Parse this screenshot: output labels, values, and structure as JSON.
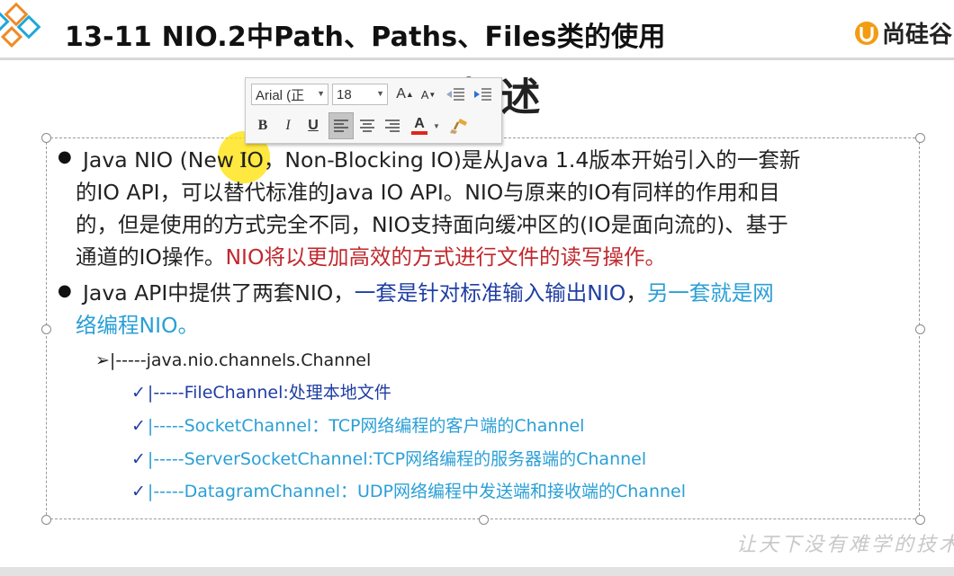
{
  "header": {
    "title": "13-11 NIO.2中Path、Paths、Files类的使用",
    "brand_text": "尚硅谷",
    "diamond_colors": [
      "#f08a24",
      "#1fa7d8"
    ]
  },
  "slide": {
    "heading_behind": "O 概述"
  },
  "mini_toolbar": {
    "font_name": "Arial (正",
    "font_size": "18",
    "grow_font_label": "A",
    "shrink_font_label": "A",
    "bold_label": "B",
    "italic_label": "I",
    "underline_label": "U",
    "font_color_label": "A",
    "font_color": "#e0261b"
  },
  "body": {
    "bullet1": {
      "line1": "Java NIO (New IO，Non-Blocking IO)是从Java 1.4版本开始引入的一套新",
      "line2": "的IO API，可以替代标准的Java IO API。NIO与原来的IO有同样的作用和目",
      "line3": "的，但是使用的方式完全不同，NIO支持面向缓冲区的(IO是面向流的)、基于",
      "line4_plain": "通道的IO操作。",
      "line4_red": "NIO将以更加高效的方式进行文件的读写操作。"
    },
    "bullet2": {
      "line1_plain": "Java API中提供了两套NIO，",
      "line1_navy": "一套是针对标准输入输出NIO",
      "line1_comma": "，",
      "line1_sky": "另一套就是网",
      "line2_sky": "络编程NIO。"
    },
    "channel_tree": {
      "root": "➢|-----java.nio.channels.Channel",
      "items": [
        {
          "check": "✓",
          "text": "|-----FileChannel:处理本地文件"
        },
        {
          "check": "✓",
          "text": "|-----SocketChannel：TCP网络编程的客户端的Channel"
        },
        {
          "check": "✓",
          "text": "|-----ServerSocketChannel:TCP网络编程的服务器端的Channel"
        },
        {
          "check": "✓",
          "text": "|-----DatagramChannel：UDP网络编程中发送端和接收端的Channel"
        }
      ]
    }
  },
  "watermark": "让天下没有难学的技术",
  "colors": {
    "red_text": "#c0282d",
    "navy_text": "#1f3ea3",
    "sky_text": "#2a9fd6",
    "cursor_highlight": "#ffe000"
  }
}
